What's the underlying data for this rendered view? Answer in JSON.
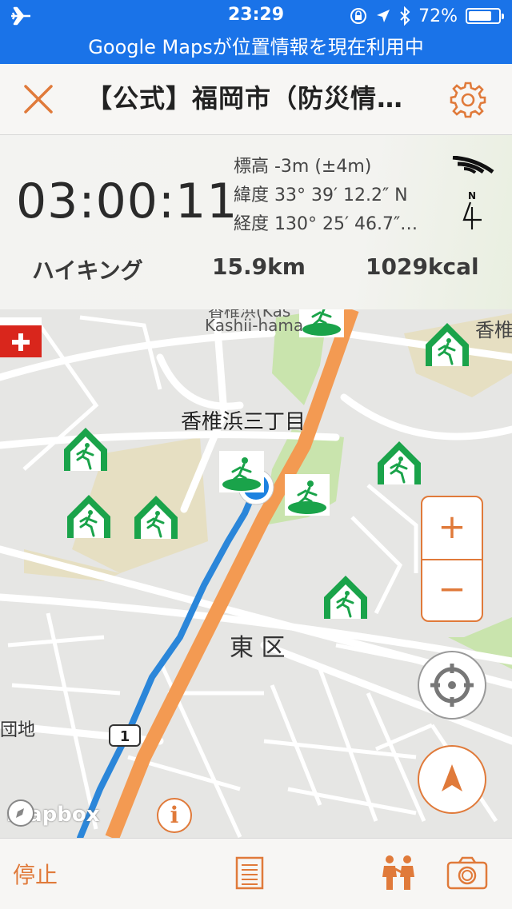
{
  "status_bar": {
    "time": "23:29",
    "battery": "72%"
  },
  "location_banner": "Google Mapsが位置情報を現在利用中",
  "header": {
    "title": "【公式】福岡市（防災情…"
  },
  "stats": {
    "elapsed": "03:00:11",
    "elevation": "標高 -3m (±4m)",
    "latitude": "緯度 33° 39′ 12.2″ N",
    "longitude": "経度 130° 25′ 46.7″…",
    "activity": "ハイキング",
    "distance": "15.9km",
    "calories": "1029kcal"
  },
  "map": {
    "labels": {
      "kashii_top": "香椎浜(Kas",
      "kashii_hama": "Kashii-hama",
      "kashii_right": "香椎",
      "sanchome": "香椎浜三丁目",
      "higashi_ku": "東 区",
      "danchi": "団地",
      "route_shield": "1"
    },
    "zoom_in": "+",
    "zoom_out": "−",
    "attribution": "mapbox",
    "info": "i"
  },
  "bottom_bar": {
    "stop": "停止"
  },
  "colors": {
    "accent": "#e07a3a",
    "blue": "#1a73e8",
    "route_orange": "#f39a52",
    "route_blue": "#2b86d9",
    "shelter_green": "#1aa34a",
    "park_green": "#c9e4ad",
    "area_tan": "#e6dfc2"
  },
  "icons": [
    "airplane-icon",
    "lock-rotation-icon",
    "location-arrow-icon",
    "bluetooth-icon",
    "battery-icon",
    "close-icon",
    "gear-icon",
    "signal-icon",
    "compass-icon",
    "evacuation-shelter-icon",
    "zoom-in-icon",
    "zoom-out-icon",
    "locate-icon",
    "navigation-arrow-icon",
    "info-icon",
    "first-aid-icon",
    "list-icon",
    "people-icon",
    "camera-icon"
  ]
}
